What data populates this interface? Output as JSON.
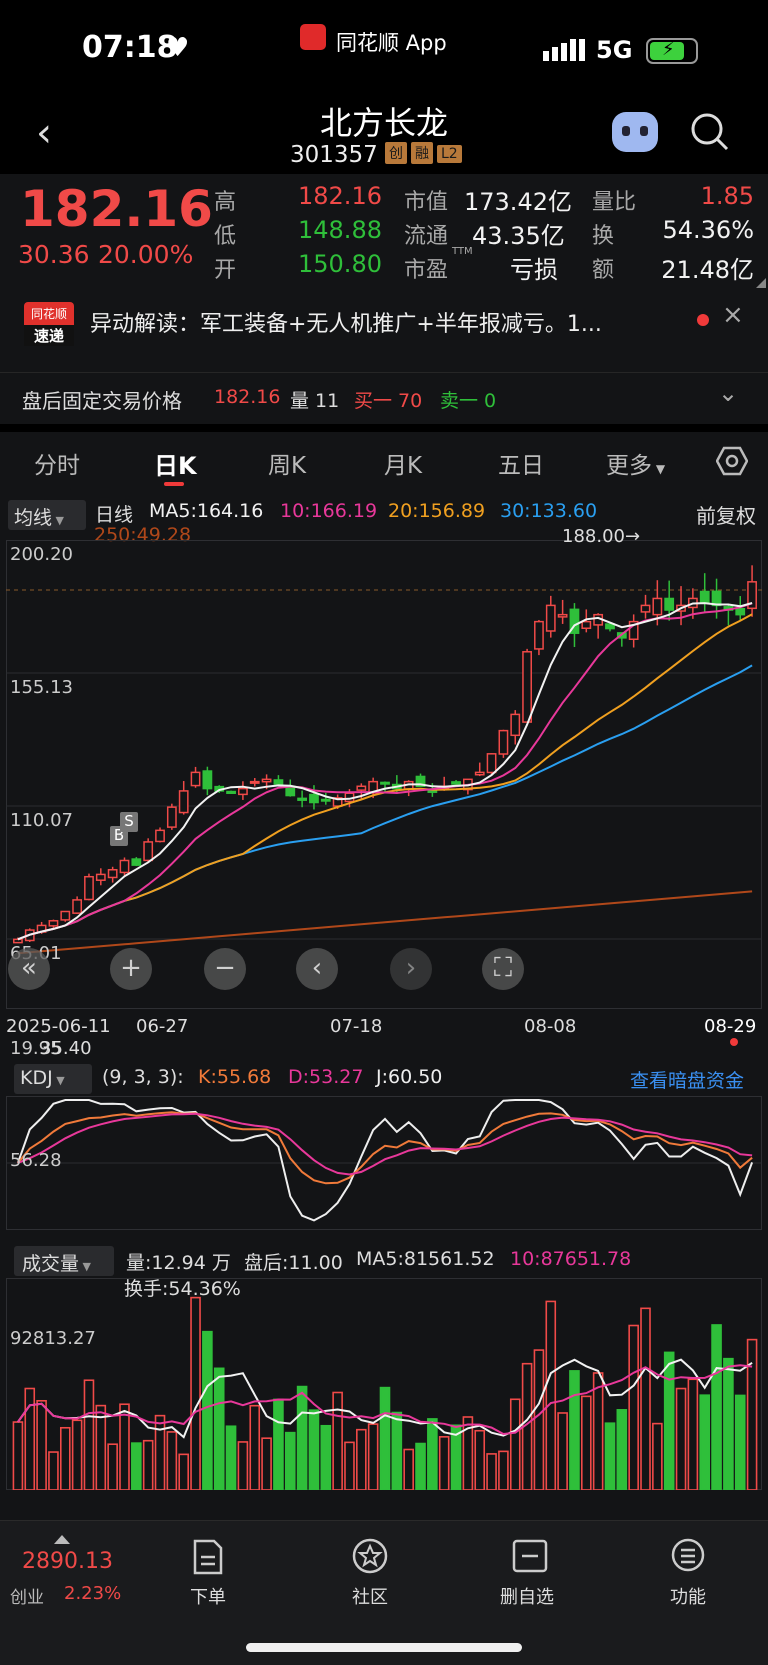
{
  "status": {
    "time": "07:18",
    "app": "同花顺 App",
    "network": "5G"
  },
  "stock": {
    "name": "北方长龙",
    "code": "301357",
    "tags": [
      "创",
      "融",
      "L2"
    ],
    "price": "182.16",
    "change": "30.36",
    "pct": "20.00%",
    "high_l": "高",
    "high": "182.16",
    "low_l": "低",
    "low": "148.88",
    "open_l": "开",
    "open": "150.80",
    "mcap_l": "市值",
    "mcap": "173.42亿",
    "float_l": "流通",
    "float": "43.35亿",
    "pe_l": "市盈",
    "pe_sup": "TTM",
    "pe": "亏损",
    "vr_l": "量比",
    "vr": "1.85",
    "turn_l": "换",
    "turn": "54.36%",
    "amt_l": "额",
    "amt": "21.48亿"
  },
  "news": {
    "logo1": "同花顺",
    "logo2": "速递",
    "text": "异动解读：军工装备+无人机推广+半年报减亏。1..."
  },
  "after": {
    "label": "盘后固定交易价格",
    "price": "182.16",
    "vol": "量 11",
    "buy": "买一 70",
    "sell": "卖一 0"
  },
  "tabs": [
    "分时",
    "日K",
    "周K",
    "月K",
    "五日",
    "更多"
  ],
  "ma": {
    "type": "均线",
    "period": "日线",
    "ma5": "MA5:164.16",
    "ma10": "10:166.19",
    "ma20": "20:156.89",
    "ma30": "30:133.60",
    "ma250": "250:49.28",
    "adj": "前复权"
  },
  "axis": {
    "y1": "200.20",
    "y2": "155.13",
    "y3": "110.07",
    "y4": "65.01",
    "y5": "19.95",
    "low": "35.40",
    "max_label": "188.00→",
    "d1": "2025-06-11",
    "d2": "06-27",
    "d3": "07-18",
    "d4": "08-08",
    "d5": "08-29"
  },
  "markers": {
    "b": "B",
    "s": "S"
  },
  "kdj": {
    "name": "KDJ",
    "param": "(9, 3, 3):",
    "k": "K:55.68",
    "d": "D:53.27",
    "j": "J:60.50",
    "link": "查看暗盘资金",
    "level": "56.28"
  },
  "vol": {
    "name": "成交量",
    "v": "量:12.94 万",
    "after": "盘后:11.00",
    "ma5": "MA5:81561.52",
    "ma10": "10:87651.78",
    "turn": "换手:54.36%",
    "level": "92813.27"
  },
  "bottom": {
    "idx_val": "2890.13",
    "idx_name": "创业",
    "idx_pct": "2.23%",
    "items": [
      "下单",
      "社区",
      "删自选",
      "功能"
    ]
  },
  "colors": {
    "up": "#f04a48",
    "down": "#2fbf3a",
    "ma5": "#f2f2f2",
    "ma10": "#e8389a",
    "ma20": "#f0a020",
    "ma30": "#2a9ff0",
    "ma250": "#b0481a"
  },
  "chart_data": {
    "type": "candlestick",
    "ylim": [
      19.95,
      200.2
    ],
    "closes": [
      28,
      32,
      34,
      36,
      40,
      45,
      55,
      56,
      58,
      62,
      60,
      70,
      75,
      85,
      92,
      100,
      93,
      92,
      91,
      93,
      96,
      97,
      95,
      90,
      88,
      87,
      88,
      89,
      91,
      94,
      96,
      95,
      93,
      96,
      94,
      92,
      94,
      95,
      97,
      100,
      108,
      118,
      125,
      152,
      165,
      172,
      168,
      160,
      165,
      168,
      162,
      158,
      165,
      172,
      175,
      170,
      172,
      175,
      173,
      172,
      170,
      168,
      182.16
    ]
  }
}
